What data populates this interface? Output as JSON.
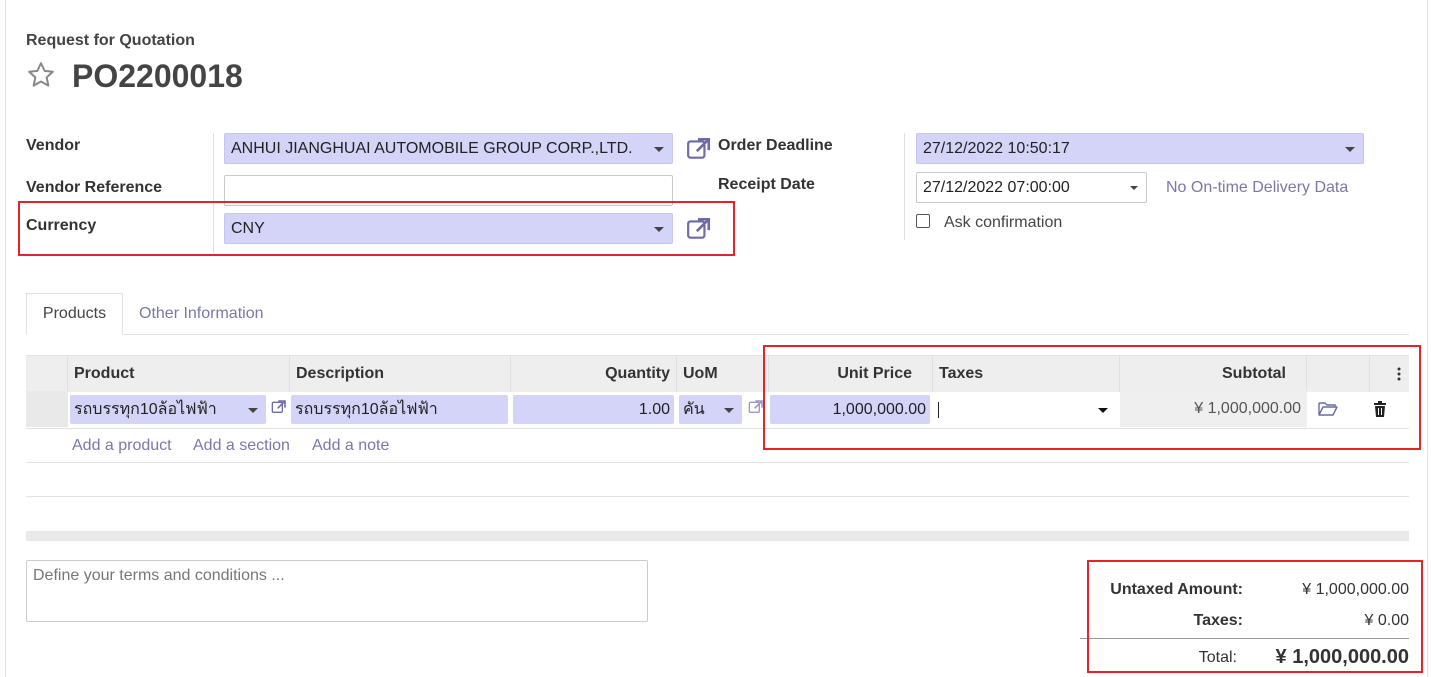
{
  "header": {
    "doc_type": "Request for Quotation",
    "doc_number": "PO2200018"
  },
  "form": {
    "vendor_label": "Vendor",
    "vendor_value": "ANHUI JIANGHUAI AUTOMOBILE GROUP CORP.,LTD.",
    "vendor_ref_label": "Vendor Reference",
    "vendor_ref_value": "",
    "currency_label": "Currency",
    "currency_value": "CNY",
    "order_deadline_label": "Order Deadline",
    "order_deadline_value": "27/12/2022 10:50:17",
    "receipt_date_label": "Receipt Date",
    "receipt_date_value": "27/12/2022 07:00:00",
    "on_time_text": "No On-time Delivery Data",
    "ask_confirmation_label": "Ask confirmation"
  },
  "tabs": [
    {
      "label": "Products",
      "active": true
    },
    {
      "label": "Other Information",
      "active": false
    }
  ],
  "lines_table": {
    "columns": {
      "product": "Product",
      "description": "Description",
      "quantity": "Quantity",
      "uom": "UoM",
      "unit_price": "Unit Price",
      "taxes": "Taxes",
      "subtotal": "Subtotal"
    },
    "rows": [
      {
        "product": "รถบรรทุก10ล้อไฟฟ้า",
        "description": "รถบรรทุก10ล้อไฟฟ้า",
        "quantity": "1.00",
        "uom": "คัน",
        "unit_price": "1,000,000.00",
        "taxes": "",
        "subtotal": "¥ 1,000,000.00"
      }
    ],
    "add_product": "Add a product",
    "add_section": "Add a section",
    "add_note": "Add a note"
  },
  "notes": {
    "terms_placeholder": "Define your terms and conditions ..."
  },
  "totals": {
    "untaxed_label": "Untaxed Amount:",
    "untaxed_value": "¥ 1,000,000.00",
    "taxes_label": "Taxes:",
    "taxes_value": "¥ 0.00",
    "total_label": "Total:",
    "total_value": "¥ 1,000,000.00"
  },
  "colors": {
    "field_bg": "#d4d3f8",
    "highlight_red": "#e0262a",
    "link": "#7a78a8"
  },
  "icons": [
    "star-icon",
    "external-link-icon",
    "folder-open-icon",
    "trash-icon",
    "kebab-menu-icon",
    "dropdown-caret-icon"
  ]
}
